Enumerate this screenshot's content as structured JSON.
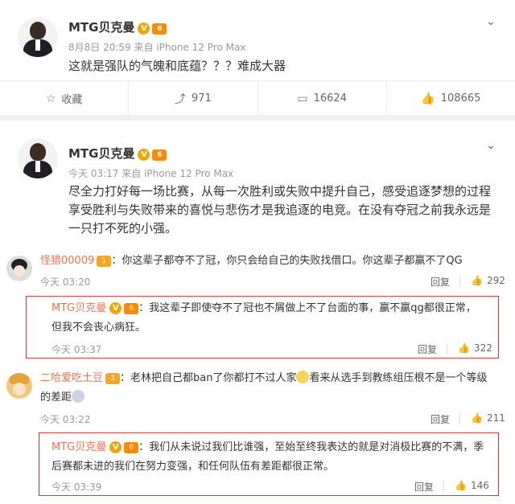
{
  "post1": {
    "user": "MTG贝克曼",
    "v_badge": "V",
    "level_badge": "6",
    "meta_time": "8月8日 20:59",
    "meta_source_prefix": "来自",
    "meta_source": "iPhone 12 Pro Max",
    "text": "这就是强队的气魄和底蕴？？？难成大器",
    "actions": {
      "favorite_label": "收藏",
      "repost_count": "971",
      "comment_count": "16624",
      "like_count": "108665"
    }
  },
  "post2": {
    "user": "MTG贝克曼",
    "v_badge": "V",
    "level_badge": "6",
    "meta_time": "今天 03:17",
    "meta_source_prefix": "来自",
    "meta_source": "iPhone 12 Pro Max",
    "text_lines": [
      "尽全力打好每一场比赛，从每一次胜利或失败中提升自己，感受追逐梦想的过程",
      "享受胜利与失败带来的喜悦与悲伤才是我追逐的电竞。在没有夺冠之前我永远是",
      "一只打不死的小强。"
    ]
  },
  "comments": [
    {
      "user": "怪猎00009",
      "badge": "1",
      "text_lines": [
        "：你这辈子都夺不了冠，你只会给自己的失败找借口。你这辈子都赢不了QG"
      ],
      "time": "今天 03:20",
      "reply_label": "回复",
      "likes": "292"
    },
    {
      "user": "MTG贝克曼",
      "badge": "6",
      "v_badge": "V",
      "text_lines": [
        "：我这辈子即使夺不了冠也不屑做上不了台面的事，赢不赢qg都很正常，",
        "但我不会丧心病狂。"
      ],
      "time": "今天 03:37",
      "reply_label": "回复",
      "likes": "322"
    },
    {
      "user": "二哈爱吃土豆",
      "badge": "3",
      "text_lines": [
        "：老林把自己都ban了你都打不过人家",
        "看来从选手到教练组压根不是一个等级",
        "的差距"
      ],
      "time": "今天 03:22",
      "reply_label": "回复",
      "likes": "211"
    },
    {
      "user": "MTG贝克曼",
      "badge": "6",
      "v_badge": "V",
      "text_lines": [
        "：我们从未说过我们比谁强，至始至终我表达的就是对消极比赛的不满，季",
        "后赛都未进的我们在努力变强，和任何队伍有差距都很正常。"
      ],
      "time": "今天 03:39",
      "reply_label": "回复",
      "likes": "146"
    }
  ],
  "icons": {
    "chevron": "chevron-down-icon",
    "favorite": "star-icon",
    "repost": "repost-icon",
    "comment": "comment-icon",
    "like": "thumbs-up-icon"
  },
  "colors": {
    "highlight_box": "#d9313a",
    "comment_username": "#eb7350",
    "background": "#eef0f3"
  }
}
